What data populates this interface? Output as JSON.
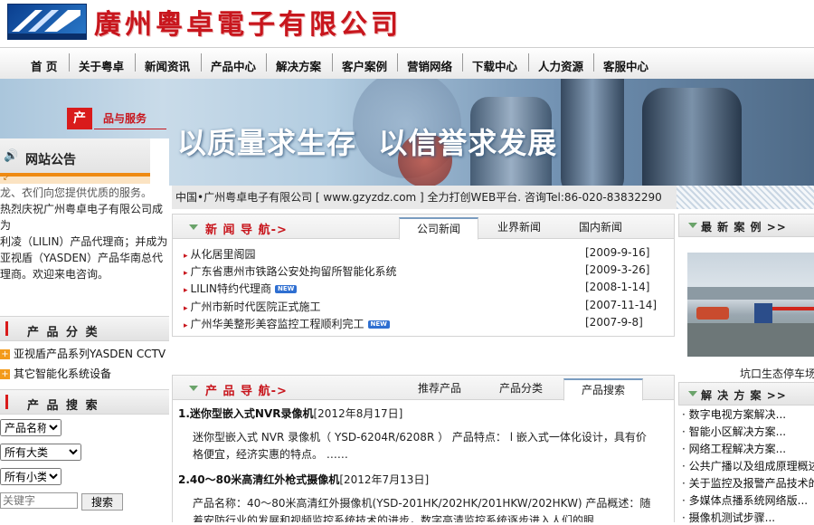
{
  "header": {
    "company_name": "廣州粵卓電子有限公司"
  },
  "nav": {
    "items": [
      "首 页",
      "关于粤卓",
      "新闻资讯",
      "产品中心",
      "解决方案",
      "客户案例",
      "营销网络",
      "下载中心",
      "人力资源",
      "客服中心"
    ]
  },
  "banner": {
    "slogan": "以质量求生存  以信誉求发展",
    "section_badge": "产",
    "section_label": "品与服务"
  },
  "notice": {
    "title": "网站公告",
    "lines": [
      "热烈庆祝广州粤卓电子有限公司成为",
      "利凌（LILIN）产品代理商；并成为",
      "亚视盾（YASDEN）产品华南总代",
      "理商。欢迎来电咨询。"
    ],
    "partial_top": "龙、衣们向您提供优质的服务。"
  },
  "categories": {
    "title": "产 品 分 类",
    "items": [
      "亚视盾产品系列YASDEN CCTV",
      "其它智能化系统设备"
    ]
  },
  "search": {
    "title": "产 品 搜 索",
    "field_select": "产品名称",
    "big_class_select": "所有大类",
    "small_class_select": "所有小类",
    "keyword_placeholder": "关键字",
    "button": "搜索"
  },
  "infobar": {
    "text": "中国•广州粤卓电子有限公司 [ www.gzyzdz.com ] 全力打创WEB平台. 咨询Tel:86-020-83832290"
  },
  "news": {
    "title": "新 闻 导 航->",
    "tabs": [
      "公司新闻",
      "业界新闻",
      "国内新闻"
    ],
    "active_tab": "公司新闻",
    "items": [
      {
        "title": "从化居里阁园",
        "date": "[2009-9-16]",
        "new": false
      },
      {
        "title": "广东省惠州市铁路公安处拘留所智能化系统",
        "date": "[2009-3-26]",
        "new": false
      },
      {
        "title": "LILIN特约代理商",
        "date": "[2008-1-14]",
        "new": true
      },
      {
        "title": "广州市新时代医院正式施工",
        "date": "[2007-11-14]",
        "new": false
      },
      {
        "title": "广州华美整形美容监控工程顺利完工",
        "date": "[2007-9-8]",
        "new": true
      }
    ],
    "new_tag": "NEW"
  },
  "products": {
    "title": "产 品 导 航->",
    "tabs": [
      "推荐产品",
      "产品分类",
      "产品搜索"
    ],
    "active_tab": "产品搜索",
    "items": [
      {
        "title": "1.迷你型嵌入式NVR录像机",
        "date": "[2012年8月17日]",
        "desc": "迷你型嵌入式 NVR 录像机（ YSD-6204R/6208R ） 产品特点： l        嵌入式一体化设计，具有价格便宜，经济实惠的特点。  ……"
      },
      {
        "title": "2.40～80米高清红外枪式摄像机",
        "date": "[2012年7月13日]",
        "desc": "产品名称：40～80米高清红外摄像机(YSD-201HK/202HK/201HKW/202HKW)          产品概述：随着安防行业的发展和视频监控系统技术的进步，数字高清监控系统逐步进入人们的眼"
      }
    ]
  },
  "cases": {
    "title": "最 新 案 例 >>",
    "caption": "坑口生态停车场"
  },
  "solutions": {
    "title": "解 决 方 案 >>",
    "items": [
      "数字电视方案解决...",
      "智能小区解决方案...",
      "网络工程解决方案...",
      "公共广播以及组成原理概述",
      "关于监控及报警产品技术的",
      "多媒体点播系统网络版...",
      "摄像机测试步骤..."
    ]
  },
  "colors": {
    "brand_red": "#c8161d",
    "accent_orange": "#ef8a12",
    "new_blue": "#2f6fd1"
  }
}
